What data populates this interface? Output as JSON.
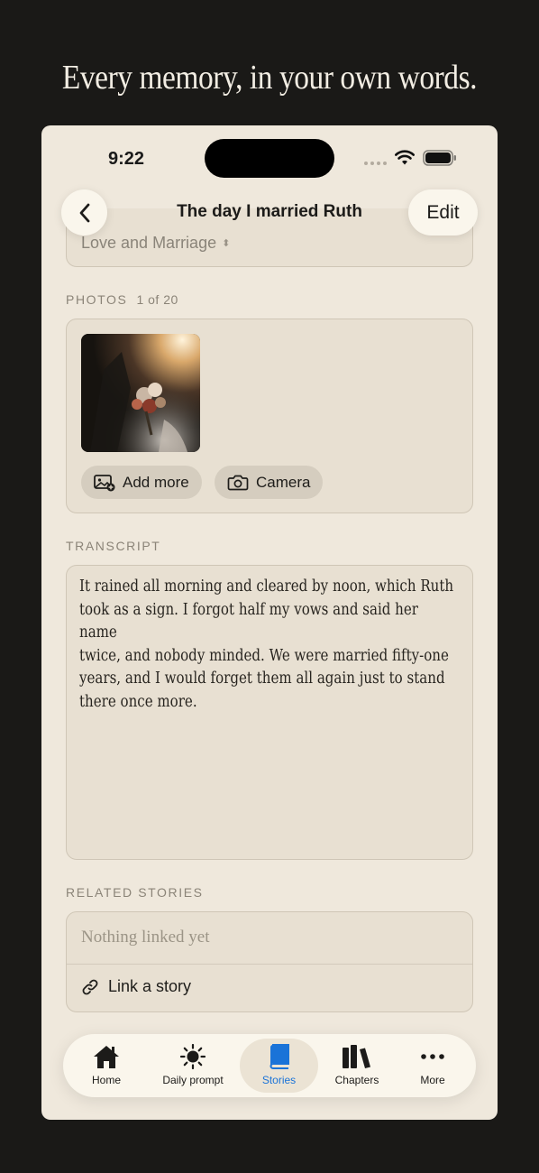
{
  "headline": "Every memory, in your own words.",
  "status": {
    "time": "9:22"
  },
  "nav": {
    "title": "The day I married Ruth",
    "edit_label": "Edit"
  },
  "chapter": {
    "value": "Love and Marriage"
  },
  "photos": {
    "label": "PHOTOS",
    "count": "1 of 20",
    "add_more_label": "Add more",
    "camera_label": "Camera"
  },
  "transcript": {
    "label": "TRANSCRIPT",
    "lines": [
      "It rained all morning and cleared by noon, which Ruth",
      "took as a sign. I forgot half my vows and said her name",
      "twice, and nobody minded. We were married fifty-one",
      "years, and I would forget them all again just to stand",
      "there once more."
    ]
  },
  "related": {
    "label": "RELATED STORIES",
    "empty_text": "Nothing linked yet",
    "link_label": "Link a story"
  },
  "tabs": [
    {
      "label": "Home",
      "icon": "home-icon"
    },
    {
      "label": "Daily prompt",
      "icon": "sun-icon"
    },
    {
      "label": "Stories",
      "icon": "book-icon",
      "active": true
    },
    {
      "label": "Chapters",
      "icon": "books-icon"
    },
    {
      "label": "More",
      "icon": "more-dots-icon"
    }
  ],
  "colors": {
    "background": "#1a1917",
    "screen": "#efe8dc",
    "accent": "#1a73d8"
  }
}
